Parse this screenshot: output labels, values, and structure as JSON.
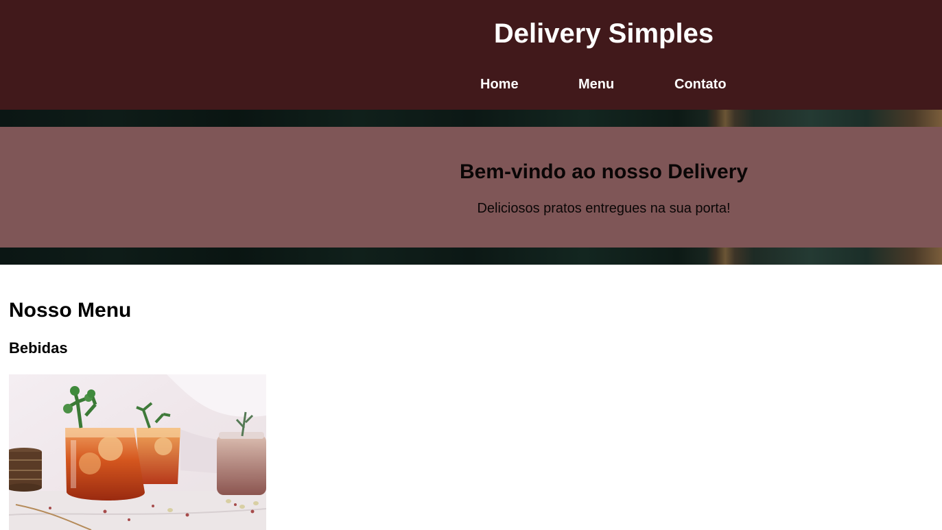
{
  "header": {
    "title": "Delivery Simples",
    "nav": [
      {
        "label": "Home"
      },
      {
        "label": "Menu"
      },
      {
        "label": "Contato"
      }
    ]
  },
  "hero": {
    "title": "Bem-vindo ao nosso Delivery",
    "subtitle": "Deliciosos pratos entregues na sua porta!"
  },
  "menu": {
    "heading": "Nosso Menu",
    "categories": [
      {
        "name": "Bebidas"
      }
    ]
  },
  "colors": {
    "header_bg": "#41191b",
    "hero_overlay": "#7f5657",
    "text_light": "#ffffff",
    "text_dark": "#000000"
  }
}
